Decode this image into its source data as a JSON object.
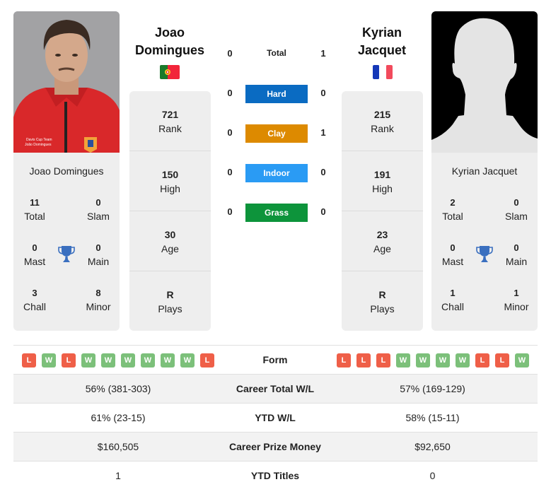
{
  "colors": {
    "hard": "#0a6bc2",
    "clay": "#dd8a00",
    "indoor": "#2a9bf4",
    "grass": "#0d943b",
    "form_loss": "#ef5f48",
    "form_win": "#7cc07a",
    "trophy": "#3a6fbf"
  },
  "player1": {
    "name_line1": "Joao",
    "name_line2": "Domingues",
    "card_name": "Joao Domingues",
    "flag": "portugal-flag",
    "photo": "player-photo",
    "stats": [
      {
        "value": "721",
        "label": "Rank"
      },
      {
        "value": "150",
        "label": "High"
      },
      {
        "value": "30",
        "label": "Age"
      },
      {
        "value": "R",
        "label": "Plays"
      }
    ],
    "titles": {
      "total": {
        "value": "11",
        "label": "Total"
      },
      "slam": {
        "value": "0",
        "label": "Slam"
      },
      "mast": {
        "value": "0",
        "label": "Mast"
      },
      "main": {
        "value": "0",
        "label": "Main"
      },
      "chall": {
        "value": "3",
        "label": "Chall"
      },
      "minor": {
        "value": "8",
        "label": "Minor"
      }
    },
    "form": [
      "L",
      "W",
      "L",
      "W",
      "W",
      "W",
      "W",
      "W",
      "W",
      "L"
    ]
  },
  "player2": {
    "name_line1": "Kyrian",
    "name_line2": "Jacquet",
    "card_name": "Kyrian Jacquet",
    "flag": "france-flag",
    "photo": "placeholder-silhouette",
    "stats": [
      {
        "value": "215",
        "label": "Rank"
      },
      {
        "value": "191",
        "label": "High"
      },
      {
        "value": "23",
        "label": "Age"
      },
      {
        "value": "R",
        "label": "Plays"
      }
    ],
    "titles": {
      "total": {
        "value": "2",
        "label": "Total"
      },
      "slam": {
        "value": "0",
        "label": "Slam"
      },
      "mast": {
        "value": "0",
        "label": "Mast"
      },
      "main": {
        "value": "0",
        "label": "Main"
      },
      "chall": {
        "value": "1",
        "label": "Chall"
      },
      "minor": {
        "value": "1",
        "label": "Minor"
      }
    },
    "form": [
      "L",
      "L",
      "L",
      "W",
      "W",
      "W",
      "W",
      "L",
      "L",
      "W"
    ]
  },
  "h2h": {
    "total": {
      "label": "Total",
      "left": "0",
      "right": "1"
    },
    "surfaces": [
      {
        "label": "Hard",
        "left": "0",
        "right": "0"
      },
      {
        "label": "Clay",
        "left": "0",
        "right": "1"
      },
      {
        "label": "Indoor",
        "left": "0",
        "right": "0"
      },
      {
        "label": "Grass",
        "left": "0",
        "right": "0"
      }
    ]
  },
  "comparison": {
    "form_label": "Form",
    "rows": [
      {
        "label": "Career Total W/L",
        "left": "56% (381-303)",
        "right": "57% (169-129)"
      },
      {
        "label": "YTD W/L",
        "left": "61% (23-15)",
        "right": "58% (15-11)"
      },
      {
        "label": "Career Prize Money",
        "left": "$160,505",
        "right": "$92,650"
      },
      {
        "label": "YTD Titles",
        "left": "1",
        "right": "0"
      }
    ]
  }
}
